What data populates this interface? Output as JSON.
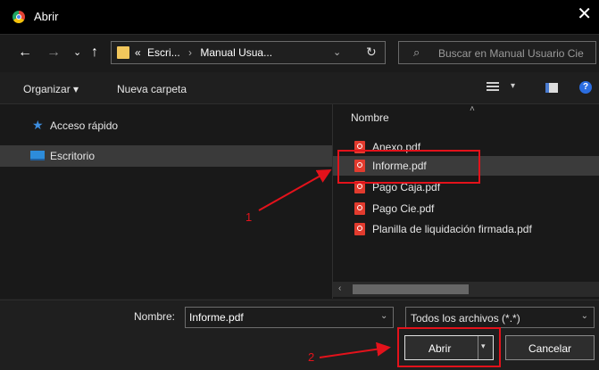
{
  "window": {
    "title": "Abrir",
    "close": "✕"
  },
  "nav": {
    "back": "←",
    "forward": "→",
    "recent": "⌄",
    "up": "↑",
    "breadcrumb": [
      "«",
      "Escri...",
      "›",
      "Manual Usua..."
    ],
    "address_dropdown": "⌄",
    "refresh": "↻",
    "search_placeholder": "Buscar en Manual Usuario Cie",
    "search_icon": "⌕"
  },
  "toolbar": {
    "organize": "Organizar ▾",
    "new_folder": "Nueva carpeta",
    "view_dropdown": "▾",
    "help": "?"
  },
  "sidebar": {
    "items": [
      {
        "label": "Acceso rápido",
        "icon": "star-icon"
      },
      {
        "label": "Escritorio",
        "icon": "desktop-icon",
        "selected": true
      }
    ]
  },
  "files": {
    "column": "Nombre",
    "sort_indicator": "˄",
    "items": [
      {
        "name": "Anexo.pdf",
        "selected": false
      },
      {
        "name": "Informe.pdf",
        "selected": true
      },
      {
        "name": "Pago Caja.pdf",
        "selected": false
      },
      {
        "name": "Pago Cie.pdf",
        "selected": false
      },
      {
        "name": "Planilla de liquidación firmada.pdf",
        "selected": false
      }
    ],
    "scroll_left": "‹"
  },
  "footer": {
    "name_label": "Nombre:",
    "name_value": "Informe.pdf",
    "name_dropdown": "⌄",
    "filter": "Todos los archivos (*.*)",
    "filter_dropdown": "⌄",
    "open": "Abrir",
    "open_split": "▾",
    "cancel": "Cancelar"
  },
  "annotations": {
    "step1": "1",
    "step2": "2"
  },
  "colors": {
    "highlight": "#e3121b",
    "accent": "#2b6de0",
    "pdf": "#e23b2e",
    "folder": "#f2c75c"
  }
}
